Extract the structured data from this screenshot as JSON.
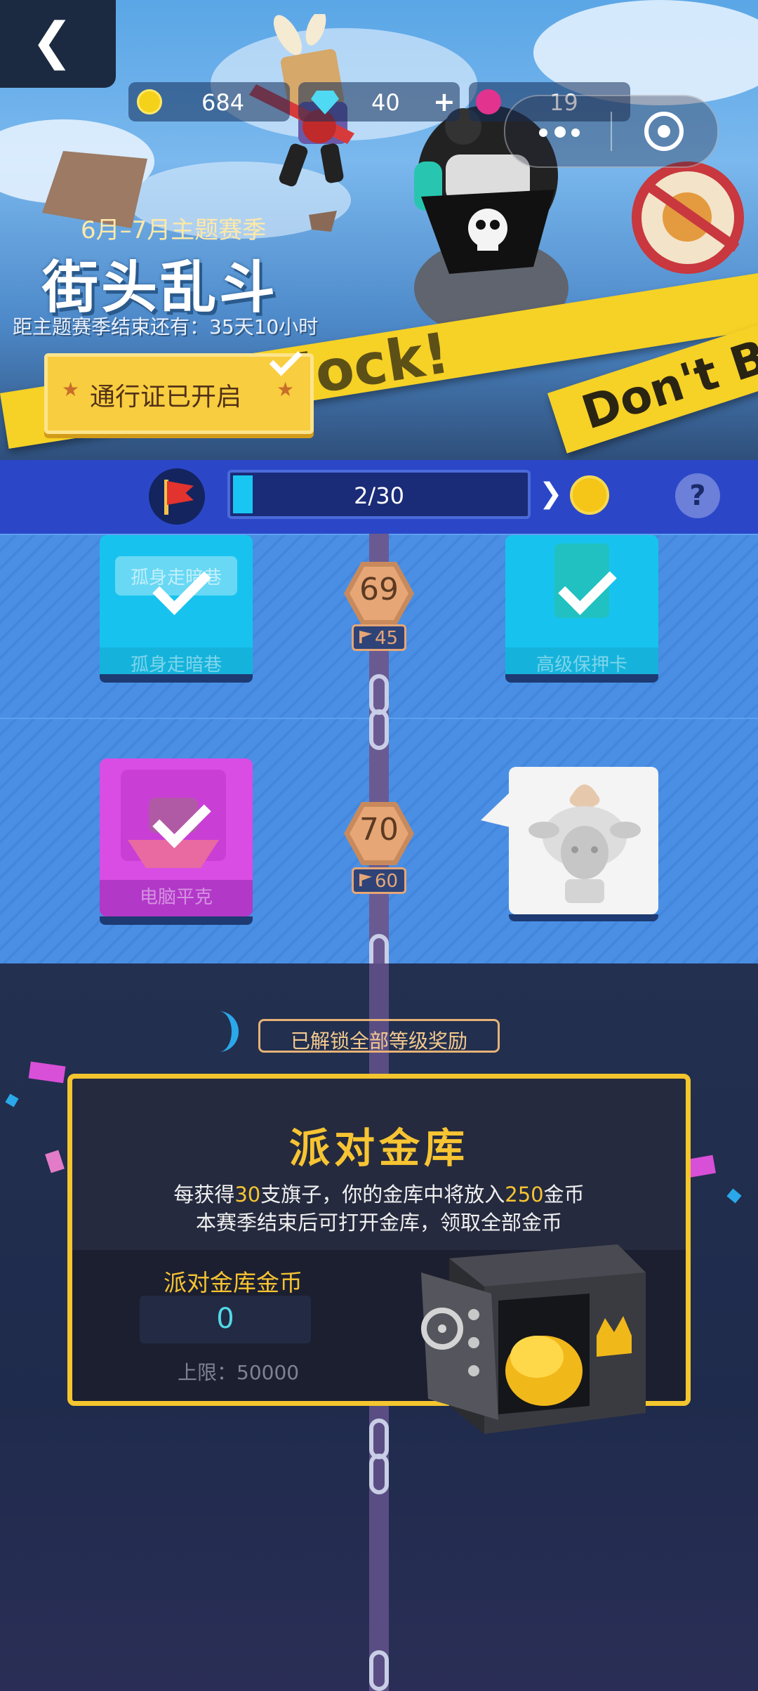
{
  "header": {
    "back_icon": "back-arrow-icon",
    "currencies": [
      {
        "icon": "gold-coin-icon",
        "value": "684"
      },
      {
        "icon": "diamond-icon",
        "value": "40",
        "add": "+"
      },
      {
        "icon": "lotus-token-icon",
        "value": "19"
      }
    ],
    "mini_program": {
      "more_icon": "more-dots-icon",
      "close_icon": "target-close-icon"
    }
  },
  "season": {
    "period": "6月–7月主题赛季",
    "title": "街头乱斗",
    "remaining": "距主题赛季结束还有：35天10小时",
    "pass_button": "通行证已开启"
  },
  "banner_tape": {
    "text1": "Block!",
    "text2": "Don't B"
  },
  "progress": {
    "text": "2/30",
    "current": 2,
    "max": 30,
    "reward_icon": "gold-coin-icon",
    "help": "?"
  },
  "levels": [
    {
      "level": "69",
      "flags": "45",
      "left_reward": {
        "name": "孤身走暗巷",
        "inner_label": "孤身走暗巷",
        "claimed": true,
        "color": "#17c3ee"
      },
      "right_reward": {
        "name": "高级保押卡",
        "claimed": true,
        "color": "#17c3ee"
      }
    },
    {
      "level": "70",
      "flags": "60",
      "left_reward": {
        "name": "电脑平克",
        "claimed": true,
        "color": "#d94de4"
      },
      "right_reward": {
        "name": "",
        "claimed": false,
        "color": "#f4f4f4"
      }
    }
  ],
  "vault": {
    "unlocked_tag": "已解锁全部等级奖励",
    "title": "派对金库",
    "line1_a": "每获得",
    "line1_n1": "30",
    "line1_b": "支旗子，你的金库中将放入",
    "line1_n2": "250",
    "line1_c": "金币",
    "line2": "本赛季结束后可打开金库，领取全部金币",
    "coins_label": "派对金库金币",
    "coins_value": "0",
    "limit": "上限：50000"
  },
  "colors": {
    "accent_gold": "#f7c432",
    "band_blue": "#4a8fe4",
    "progress_fill": "#19c6f1",
    "panel_bg": "#252a3e"
  }
}
